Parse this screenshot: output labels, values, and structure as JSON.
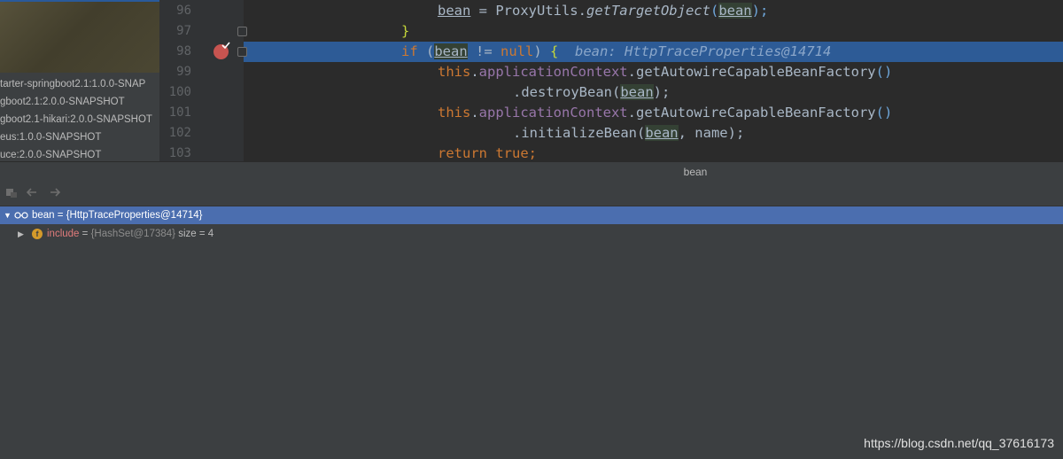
{
  "project_tree": {
    "dependencies": [
      "tarter-springboot2.1:1.0.0-SNAP",
      "gboot2.1:2.0.0-SNAPSHOT",
      "gboot2.1-hikari:2.0.0-SNAPSHOT",
      "eus:1.0.0-SNAPSHOT",
      "uce:2.0.0-SNAPSHOT"
    ]
  },
  "editor": {
    "lines": [
      {
        "num": "96"
      },
      {
        "num": "97"
      },
      {
        "num": "98"
      },
      {
        "num": "99"
      },
      {
        "num": "100"
      },
      {
        "num": "101"
      },
      {
        "num": "102"
      },
      {
        "num": "103"
      }
    ],
    "code": {
      "l96_var": "bean",
      "l96_eq": " = ProxyUtils.",
      "l96_method": "getTargetObject",
      "l96_open": "(",
      "l96_arg": "bean",
      "l96_close": ");",
      "l97": "}",
      "l98_if": "if",
      "l98_open": " (",
      "l98_var": "bean",
      "l98_rest": " != ",
      "l98_null": "null",
      "l98_close": ") ",
      "l98_brace": "{",
      "l98_hint": "  bean: HttpTraceProperties@14714",
      "l99_this": "this",
      "l99_dot": ".",
      "l99_field": "applicationContext",
      "l99_call": ".getAutowireCapableBeanFactory",
      "l99_paren": "()",
      "l100_call": ".destroyBean(",
      "l100_arg": "bean",
      "l100_close": ");",
      "l101_this": "this",
      "l101_dot": ".",
      "l101_field": "applicationContext",
      "l101_call": ".getAutowireCapableBeanFactory",
      "l101_paren": "()",
      "l102_call": ".initializeBean(",
      "l102_arg": "bean",
      "l102_rest": ", name);",
      "l103_return": "return",
      "l103_true": " true;"
    }
  },
  "debugger": {
    "title": "bean",
    "toolbar": [
      "restore-layout-icon",
      "back-arrow-icon",
      "forward-arrow-icon"
    ],
    "variables": [
      {
        "label": "bean = {HttpTraceProperties@14714}",
        "selected": true,
        "icon": "watch-glasses-icon"
      },
      {
        "name": "include",
        "eq": " = ",
        "type": "{HashSet@17384}",
        "extra": "  size = 4",
        "icon": "field-icon",
        "badge": "f"
      }
    ]
  },
  "watermark": "https://blog.csdn.net/qq_37616173",
  "colors": {
    "background": "#2b2b2b",
    "panel": "#3c3f41",
    "selection": "#4b6eaf",
    "line_highlight": "#2d5b96",
    "keyword": "#cc7832",
    "field": "#9876aa",
    "method": "#ffc66d",
    "breakpoint": "#c75450"
  }
}
